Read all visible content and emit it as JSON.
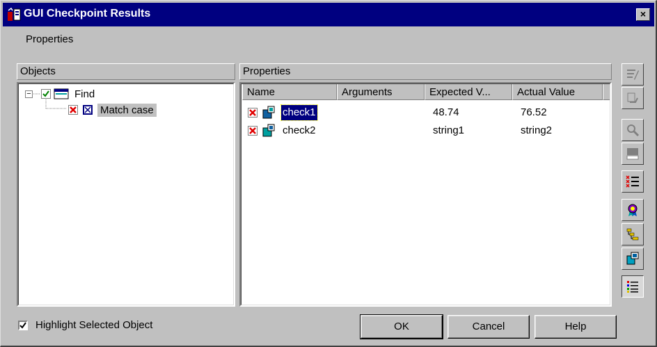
{
  "window": {
    "title": "GUI Checkpoint Results",
    "close_label": "×"
  },
  "menu": {
    "properties_label": "Properties"
  },
  "objects_panel": {
    "header": "Objects",
    "tree": [
      {
        "label": "Find",
        "expander": "−"
      },
      {
        "label": "Match case"
      }
    ]
  },
  "properties_panel": {
    "header": "Properties",
    "columns": [
      "Name",
      "Arguments",
      "Expected V...",
      "Actual Value"
    ],
    "rows": [
      {
        "name": "check1",
        "arguments": "",
        "expected": "48.74",
        "actual": "76.52"
      },
      {
        "name": "check2",
        "arguments": "",
        "expected": "string1",
        "actual": "string2"
      }
    ]
  },
  "toolbar_icons": [
    "edit-expected-icon",
    "update-expected-icon",
    "magnify-icon",
    "rct-icon",
    "list-mismatch-icon",
    "award-icon",
    "hierarchy-icon",
    "copy-icon",
    "list-view-icon"
  ],
  "footer": {
    "highlight_label": "Highlight Selected Object",
    "highlight_checked": true,
    "ok_label": "OK",
    "cancel_label": "Cancel",
    "help_label": "Help"
  },
  "colors": {
    "title_bg": "#000080",
    "face": "#c0c0c0",
    "selection": "#000080",
    "fail_red": "#e00000"
  }
}
